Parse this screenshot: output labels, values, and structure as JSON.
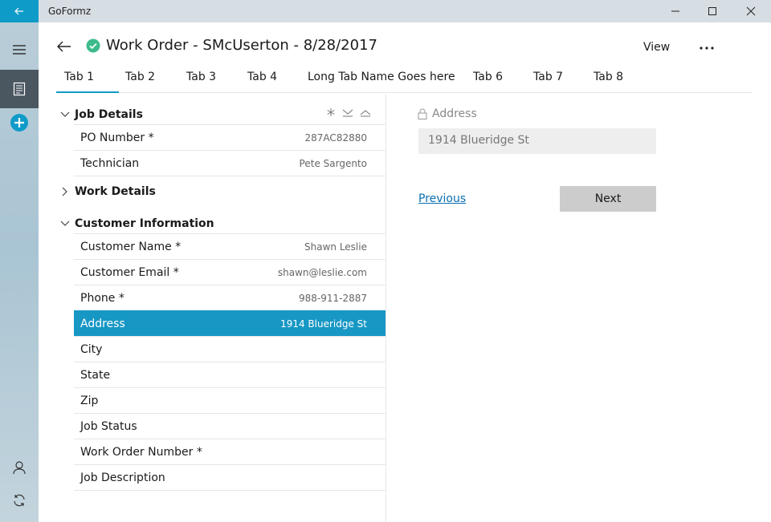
{
  "app": {
    "title": "GoFormz",
    "window_controls": [
      "minimize-icon",
      "maximize-icon",
      "close-icon"
    ]
  },
  "nav_rail": {
    "top_items": [
      "hamburger-menu-icon",
      "forms-icon",
      "add-circle-icon"
    ],
    "bottom_items": [
      "user-icon",
      "sync-icon"
    ],
    "accent_color": "#0f9bc8"
  },
  "header": {
    "title": "Work Order - SMcUserton - 8/28/2017",
    "status": "complete",
    "view_label": "View",
    "more_icon": "ellipsis-icon"
  },
  "tabs": [
    {
      "label": "Tab 1",
      "active": true
    },
    {
      "label": "Tab 2",
      "active": false
    },
    {
      "label": "Tab 3",
      "active": false
    },
    {
      "label": "Tab 4",
      "active": false
    },
    {
      "label": "Long Tab Name Goes here",
      "active": false
    },
    {
      "label": "Tab 6",
      "active": false
    },
    {
      "label": "Tab 7",
      "active": false
    },
    {
      "label": "Tab 8",
      "active": false
    }
  ],
  "sections": [
    {
      "title": "Job Details",
      "expanded": true,
      "fields": [
        {
          "label": "PO Number *",
          "value": "287AC82880"
        },
        {
          "label": "Technician",
          "value": "Pete Sargento"
        }
      ]
    },
    {
      "title": "Work Details",
      "expanded": false,
      "fields": []
    },
    {
      "title": "Customer Information",
      "expanded": true,
      "fields": [
        {
          "label": "Customer Name *",
          "value": "Shawn Leslie"
        },
        {
          "label": "Customer Email *",
          "value": "shawn@leslie.com"
        },
        {
          "label": "Phone *",
          "value": "988-911-2887"
        },
        {
          "label": "Address",
          "value": "1914 Blueridge St",
          "selected": true
        },
        {
          "label": "City",
          "value": ""
        },
        {
          "label": "State",
          "value": ""
        },
        {
          "label": "Zip",
          "value": ""
        },
        {
          "label": "Job Status",
          "value": ""
        },
        {
          "label": "Work Order Number *",
          "value": ""
        },
        {
          "label": "Job Description",
          "value": ""
        }
      ]
    }
  ],
  "detail": {
    "label": "Address",
    "value": "1914 Blueridge St",
    "locked": true,
    "previous_label": "Previous",
    "next_label": "Next"
  }
}
